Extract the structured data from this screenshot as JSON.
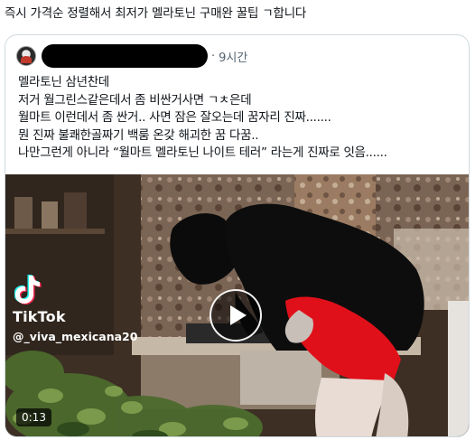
{
  "post": {
    "text": "즉시 가격순 정렬해서 최저가 멜라토닌 구매완 꿀팁 ㄱ합니다"
  },
  "quote": {
    "time_separator": "·",
    "time": "9시간",
    "lines": [
      "멜라토닌 삼년찬데",
      "저거 월그린스같은데서 좀 비싼거사면 ㄱㅊ은데",
      "월마트 이런데서 좀 싼거.. 사면 잠은 잘오는데 꿈자리 진짜.......",
      "뭔 진짜 불쾌한골짜기 백룸 온갖 해괴한 꿈 다꿈..",
      "나만그런게 아니라 “월마트 멜라토닌 나이트 테러” 라는게 진짜로 잇음......"
    ]
  },
  "video": {
    "watermark_brand": "TikTok",
    "watermark_handle": "@_viva_mexicana20",
    "duration": "0:13",
    "icons": {
      "play": "play-icon",
      "tiktok": "tiktok-logo-icon"
    }
  },
  "colors": {
    "text": "#0f1419",
    "muted": "#536471",
    "border": "#cfd9de",
    "red_costume": "#e0101a"
  }
}
